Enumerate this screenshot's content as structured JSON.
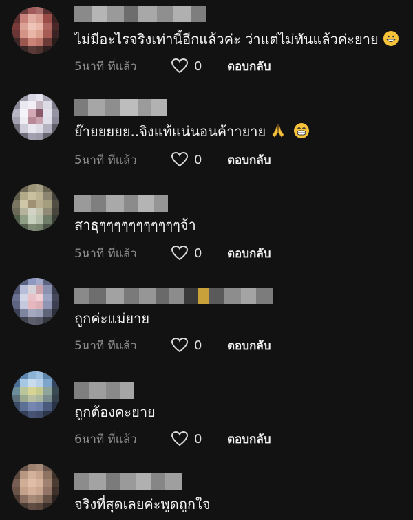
{
  "labels": {
    "reply": "ตอบกลับ"
  },
  "colors": {
    "background": "#121212",
    "text": "#f2f2f2",
    "timestamp": "#8c8c8c",
    "emoji_yellow": "#f6c23a"
  },
  "comments": [
    {
      "text": "ไม่มีอะไรจริงเท่านี้อีกแล้วค่ะ ว่าแต่ไม่ทันแล้วค่ะยาย",
      "time": "5นาที ที่แล้ว",
      "likes": "0",
      "emojis": [
        "grinning-face-icon"
      ]
    },
    {
      "text": "ย๊ายยยยย..จิงแท้แน่นอนค้าายาย",
      "time": "5นาที ที่แล้ว",
      "likes": "0",
      "emojis": [
        "folded-hands-icon",
        "grinning-face-icon"
      ]
    },
    {
      "text": "สาธุๆๆๆๆๆๆๆๆๆๆๆจ้า",
      "time": "5นาที ที่แล้ว",
      "likes": "0",
      "emojis": []
    },
    {
      "text": "ถูกค่ะแม่ยาย",
      "time": "5นาที ที่แล้ว",
      "likes": "0",
      "emojis": []
    },
    {
      "text": "ถูกต้องคะยาย",
      "time": "6นาที ที่แล้ว",
      "likes": "0",
      "emojis": []
    },
    {
      "text": "จริงที่สุดเลยค่ะพูดถูกใจ",
      "time": "",
      "likes": "",
      "emojis": []
    }
  ]
}
